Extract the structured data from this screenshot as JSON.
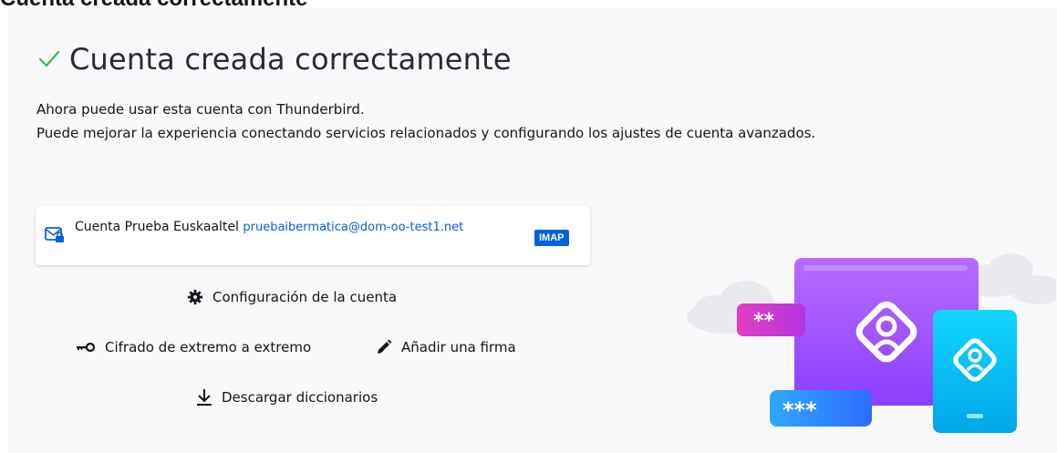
{
  "header_cut": "Cuenta creada correctamente",
  "title": "Cuenta creada correctamente",
  "intro": {
    "line1": "Ahora puede usar esta cuenta con Thunderbird.",
    "line2": "Puede mejorar la experiencia conectando servicios relacionados y configurando los ajustes de cuenta avanzados."
  },
  "account": {
    "name": "Cuenta Prueba Euskaaltel",
    "email": "pruebaibermatica@dom-oo-test1.net",
    "protocol": "IMAP",
    "icon": "mail-lock-icon"
  },
  "actions": {
    "account_settings": {
      "label": "Configuración de la cuenta",
      "icon": "gear-icon"
    },
    "e2e_encryption": {
      "label": "Cifrado de extremo a extremo",
      "icon": "key-icon"
    },
    "add_signature": {
      "label": "Añadir una firma",
      "icon": "pencil-icon"
    },
    "download_dictionaries": {
      "label": "Descargar diccionarios",
      "icon": "download-icon"
    }
  },
  "colors": {
    "success": "#3fb950",
    "link": "#0061e0",
    "panel_bg": "#f9f9fb",
    "purple": "#9747ff",
    "magenta": "#d83abe",
    "cyan": "#00c8f0",
    "blue": "#2e8bff"
  }
}
